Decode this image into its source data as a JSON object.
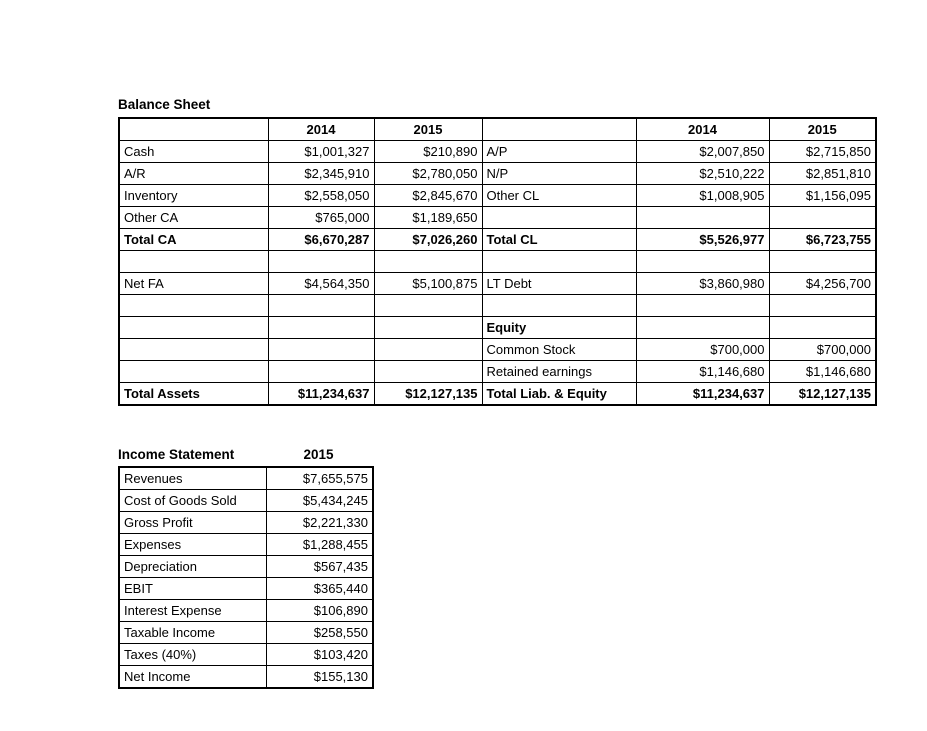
{
  "balance_sheet": {
    "title": "Balance Sheet",
    "left": {
      "header": [
        "",
        "2014",
        "2015"
      ],
      "rows": [
        {
          "label": "Cash",
          "y2014": "$1,001,327",
          "y2015": "$210,890",
          "bold": false,
          "style": "normal"
        },
        {
          "label": "A/R",
          "y2014": "$2,345,910",
          "y2015": "$2,780,050",
          "bold": false,
          "style": "normal"
        },
        {
          "label": "Inventory",
          "y2014": "$2,558,050",
          "y2015": "$2,845,670",
          "bold": false,
          "style": "normal"
        },
        {
          "label": "Other CA",
          "y2014": "$765,000",
          "y2015": "$1,189,650",
          "bold": false,
          "style": "normal"
        },
        {
          "label": "Total CA",
          "y2014": "$6,670,287",
          "y2015": "$7,026,260",
          "bold": true,
          "style": "subtotal"
        },
        {
          "label": "",
          "y2014": "",
          "y2015": "",
          "bold": false,
          "style": "spacer"
        },
        {
          "label": "Net FA",
          "y2014": "$4,564,350",
          "y2015": "$5,100,875",
          "bold": false,
          "style": "normal"
        },
        {
          "label": "",
          "y2014": "",
          "y2015": "",
          "bold": false,
          "style": "spacer"
        },
        {
          "label": "",
          "y2014": "",
          "y2015": "",
          "bold": false,
          "style": "spacer"
        },
        {
          "label": "",
          "y2014": "",
          "y2015": "",
          "bold": false,
          "style": "spacer"
        },
        {
          "label": "",
          "y2014": "",
          "y2015": "",
          "bold": false,
          "style": "spacer"
        },
        {
          "label": "Total Assets",
          "y2014": "$11,234,637",
          "y2015": "$12,127,135",
          "bold": true,
          "style": "total"
        }
      ]
    },
    "right": {
      "header": [
        "",
        "2014",
        "2015"
      ],
      "rows": [
        {
          "label": "A/P",
          "y2014": "$2,007,850",
          "y2015": "$2,715,850",
          "bold": false,
          "style": "normal"
        },
        {
          "label": "N/P",
          "y2014": "$2,510,222",
          "y2015": "$2,851,810",
          "bold": false,
          "style": "normal"
        },
        {
          "label": "Other CL",
          "y2014": "$1,008,905",
          "y2015": "$1,156,095",
          "bold": false,
          "style": "normal"
        },
        {
          "label": "",
          "y2014": "",
          "y2015": "",
          "bold": false,
          "style": "spacer"
        },
        {
          "label": "Total CL",
          "y2014": "$5,526,977",
          "y2015": "$6,723,755",
          "bold": true,
          "style": "subtotal"
        },
        {
          "label": "",
          "y2014": "",
          "y2015": "",
          "bold": false,
          "style": "spacer"
        },
        {
          "label": "LT Debt",
          "y2014": "$3,860,980",
          "y2015": "$4,256,700",
          "bold": false,
          "style": "normal"
        },
        {
          "label": "",
          "y2014": "",
          "y2015": "",
          "bold": false,
          "style": "spacer"
        },
        {
          "label": "Equity",
          "y2014": "",
          "y2015": "",
          "bold": true,
          "style": "normal"
        },
        {
          "label": "Common Stock",
          "y2014": "$700,000",
          "y2015": "$700,000",
          "bold": false,
          "style": "normal"
        },
        {
          "label": "Retained earnings",
          "y2014": "$1,146,680",
          "y2015": "$1,146,680",
          "bold": false,
          "style": "normal"
        },
        {
          "label": "Total Liab. & Equity",
          "y2014": "$11,234,637",
          "y2015": "$12,127,135",
          "bold": true,
          "style": "total"
        }
      ]
    }
  },
  "income_statement": {
    "title": "Income Statement",
    "year": "2015",
    "rows": [
      {
        "label": "Revenues",
        "value": "$7,655,575"
      },
      {
        "label": "Cost of Goods Sold",
        "value": "$5,434,245"
      },
      {
        "label": "Gross Profit",
        "value": "$2,221,330"
      },
      {
        "label": "Expenses",
        "value": "$1,288,455"
      },
      {
        "label": "Depreciation",
        "value": "$567,435"
      },
      {
        "label": "EBIT",
        "value": "$365,440"
      },
      {
        "label": "Interest Expense",
        "value": "$106,890"
      },
      {
        "label": "Taxable Income",
        "value": "$258,550"
      },
      {
        "label": "Taxes (40%)",
        "value": "$103,420"
      },
      {
        "label": "Net Income",
        "value": "$155,130"
      }
    ]
  },
  "colors": {
    "border": "#000000",
    "text": "#000000",
    "background": "#ffffff"
  }
}
